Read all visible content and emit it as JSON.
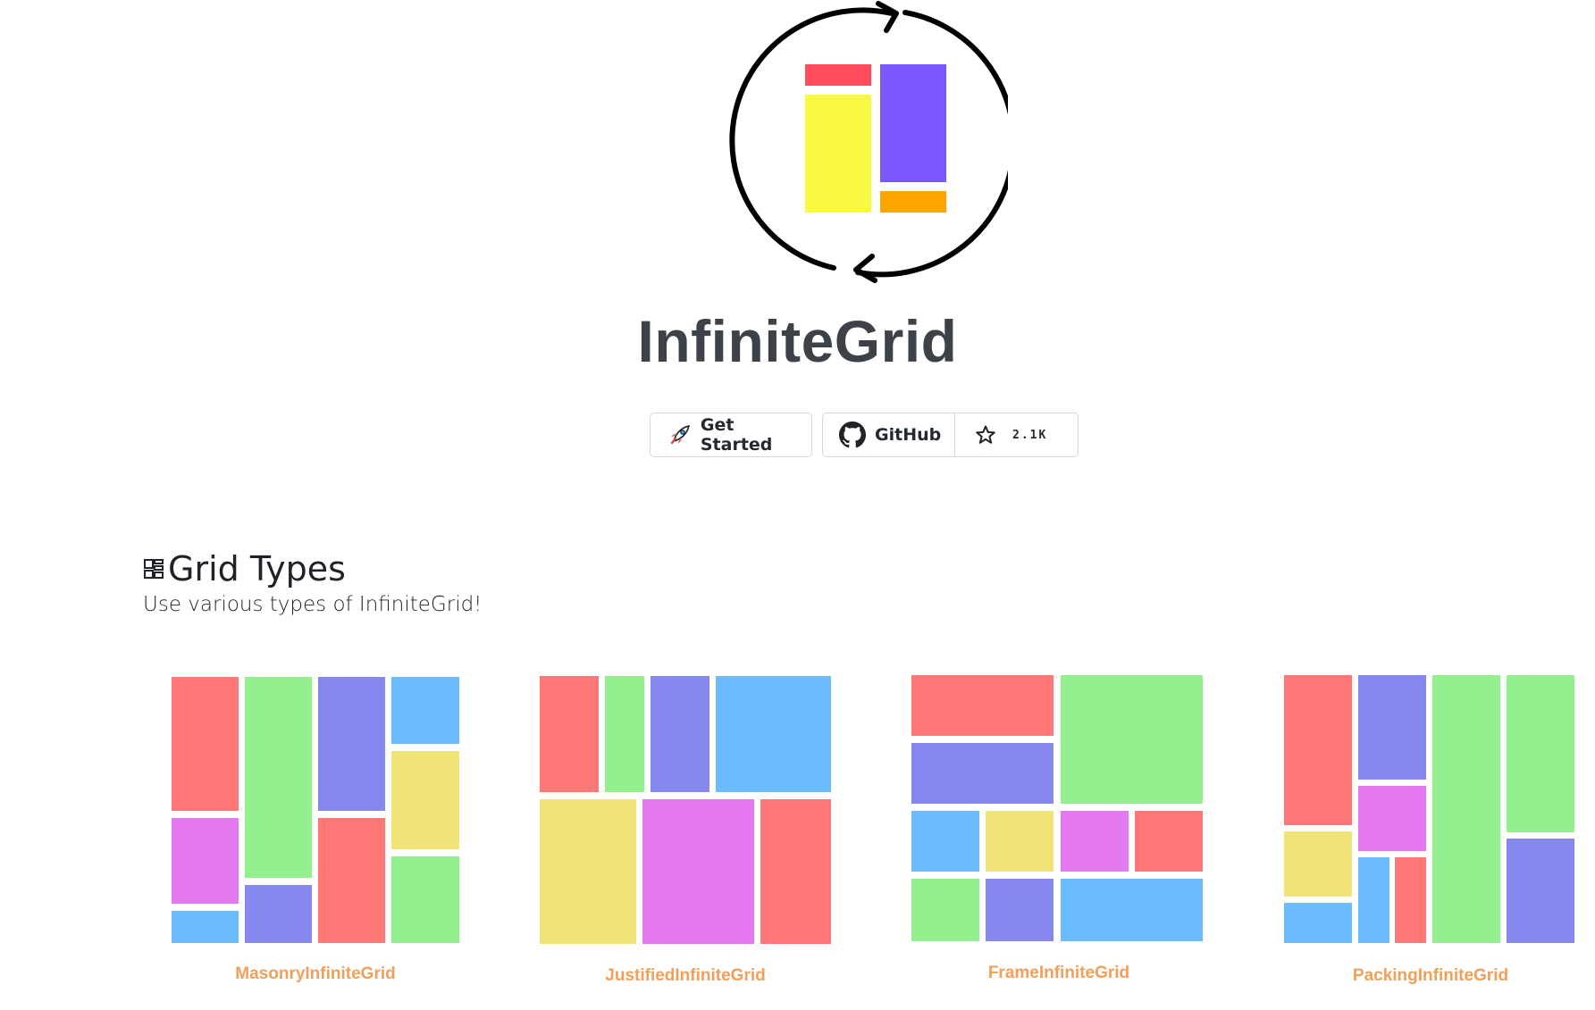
{
  "hero": {
    "title": "InfiniteGrid",
    "logo_colors": {
      "red": "#ff4d5e",
      "yellow": "#f9f942",
      "purple": "#7b57ff",
      "orange": "#ffa500",
      "ring": "#000000"
    }
  },
  "buttons": {
    "get_started": {
      "label": "Get Started",
      "icon": "rocket-icon"
    },
    "github": {
      "label": "GitHub",
      "icon": "github-icon"
    },
    "stars": {
      "count": "2.1K",
      "icon": "star-icon"
    }
  },
  "section": {
    "title": "Grid Types",
    "subtitle": "Use various types of InfiniteGrid!",
    "icon": "grid-icon"
  },
  "grid_types": [
    {
      "label": "MasonryInfiniteGrid"
    },
    {
      "label": "JustifiedInfiniteGrid"
    },
    {
      "label": "FrameInfiniteGrid"
    },
    {
      "label": "PackingInfiniteGrid"
    }
  ],
  "colors": {
    "red": "#ff7777",
    "green": "#94f08f",
    "purple": "#8787f0",
    "blue": "#6bbcff",
    "yellow": "#f0e478",
    "pink": "#e57af0",
    "link": "#f0a05a",
    "title": "#3d4249"
  }
}
